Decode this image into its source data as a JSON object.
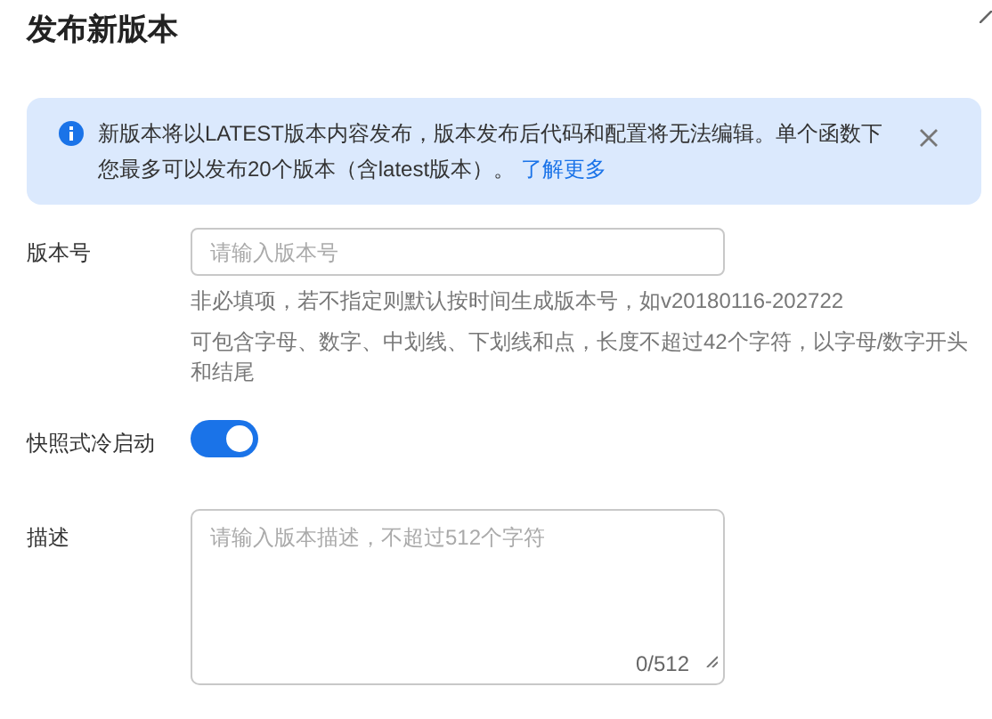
{
  "dialog": {
    "title": "发布新版本"
  },
  "alert": {
    "text": "新版本将以LATEST版本内容发布，版本发布后代码和配置将无法编辑。单个函数下您最多可以发布20个版本（含latest版本）。",
    "link": "了解更多"
  },
  "form": [
    {
      "kind": "input",
      "label": "版本号",
      "placeholder": "请输入版本号",
      "hints": [
        "非必填项，若不指定则默认按时间生成版本号，如v20180116-202722",
        "可包含字母、数字、中划线、下划线和点，长度不超过42个字符，以字母/数字开头和结尾"
      ]
    },
    {
      "kind": "switch",
      "label": "快照式冷启动",
      "on": true
    },
    {
      "kind": "textarea",
      "label": "描述",
      "placeholder": "请输入版本描述，不超过512个字符",
      "counter": "0/512"
    }
  ]
}
